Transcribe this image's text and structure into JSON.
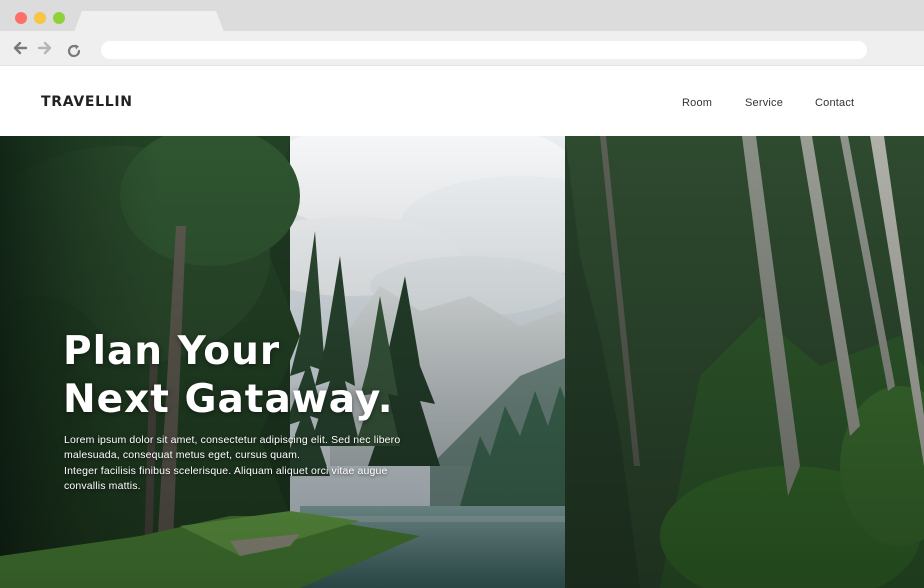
{
  "browser": {
    "buttons": [
      "back-icon",
      "forward-icon",
      "reload-icon"
    ],
    "traffic_lights": [
      "#ff6f6a",
      "#f7c443",
      "#8ed13b"
    ]
  },
  "header": {
    "logo": "TRAVELLIN",
    "nav": [
      {
        "label": "Room"
      },
      {
        "label": "Service"
      },
      {
        "label": "Contact"
      }
    ]
  },
  "hero": {
    "title_line1": "Plan Your",
    "title_line2": "Next Gataway.",
    "text_line1": "Lorem ipsum dolor sit amet, consectetur adipiscing elit. Sed nec libero",
    "text_line2": "malesuada, consequat metus eget, cursus quam.",
    "text_line3": "Integer facilisis finibus scelerisque. Aliquam aliquet orci vitae augue",
    "text_line4": "convallis mattis.",
    "image": "forest-lake-mountain-photo"
  },
  "colors": {
    "chrome": "#e6e6e6",
    "text_dark": "#222222",
    "hero_text": "#ffffff"
  }
}
